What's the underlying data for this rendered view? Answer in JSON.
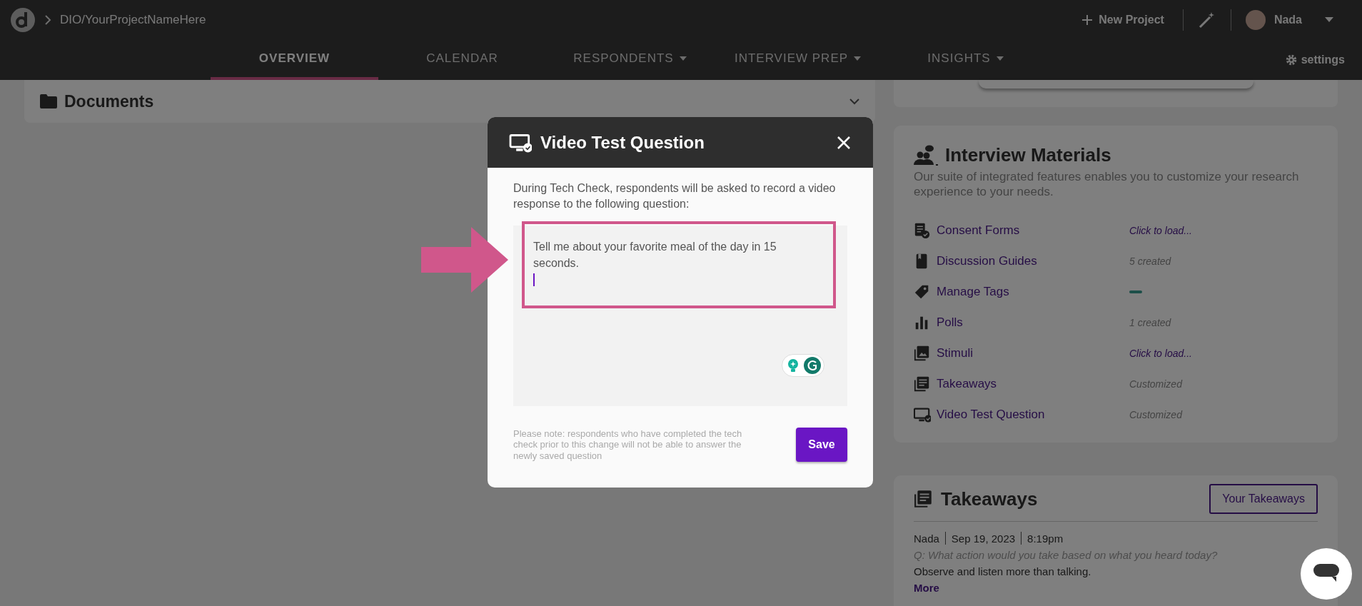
{
  "header": {
    "breadcrumb": "DIO/YourProjectNameHere",
    "new_project": "New Project",
    "user": "Nada"
  },
  "nav": {
    "tabs": [
      {
        "label": "OVERVIEW",
        "selected": true,
        "dropdown": false
      },
      {
        "label": "CALENDAR",
        "selected": false,
        "dropdown": false
      },
      {
        "label": "RESPONDENTS",
        "selected": false,
        "dropdown": true
      },
      {
        "label": "INTERVIEW PREP",
        "selected": false,
        "dropdown": true
      },
      {
        "label": "INSIGHTS",
        "selected": false,
        "dropdown": true
      }
    ],
    "settings": "settings"
  },
  "documents": {
    "title": "Documents"
  },
  "interview_materials": {
    "title": "Interview Materials",
    "description": "Our suite of integrated features enables you to customize your research experience to your needs.",
    "items": [
      {
        "label": "Consent Forms",
        "note": "Click to load...",
        "kind": "link"
      },
      {
        "label": "Discussion Guides",
        "note": "5 created",
        "kind": "muted"
      },
      {
        "label": "Manage Tags",
        "kind": "loading"
      },
      {
        "label": "Polls",
        "note": "1 created",
        "kind": "muted"
      },
      {
        "label": "Stimuli",
        "note": "Click to load...",
        "kind": "link"
      },
      {
        "label": "Takeaways",
        "note": "Customized",
        "kind": "muted"
      },
      {
        "label": "Video Test Question",
        "note": "Customized",
        "kind": "muted"
      }
    ]
  },
  "takeaways": {
    "title": "Takeaways",
    "button": "Your Takeaways",
    "entry": {
      "author": "Nada",
      "date": "Sep 19, 2023",
      "time": "8:19pm",
      "question": "Q: What action would you take based on what you heard today?",
      "answer": "Observe and listen more than talking.",
      "more": "More"
    }
  },
  "modal": {
    "title": "Video Test Question",
    "intro": "During Tech Check, respondents will be asked to record a video response to the following question:",
    "question": "Tell me about your favorite meal of the day in 15 seconds.",
    "note": "Please note: respondents who have completed the tech check prior to this change will not be able to answer the newly saved question",
    "save": "Save"
  }
}
